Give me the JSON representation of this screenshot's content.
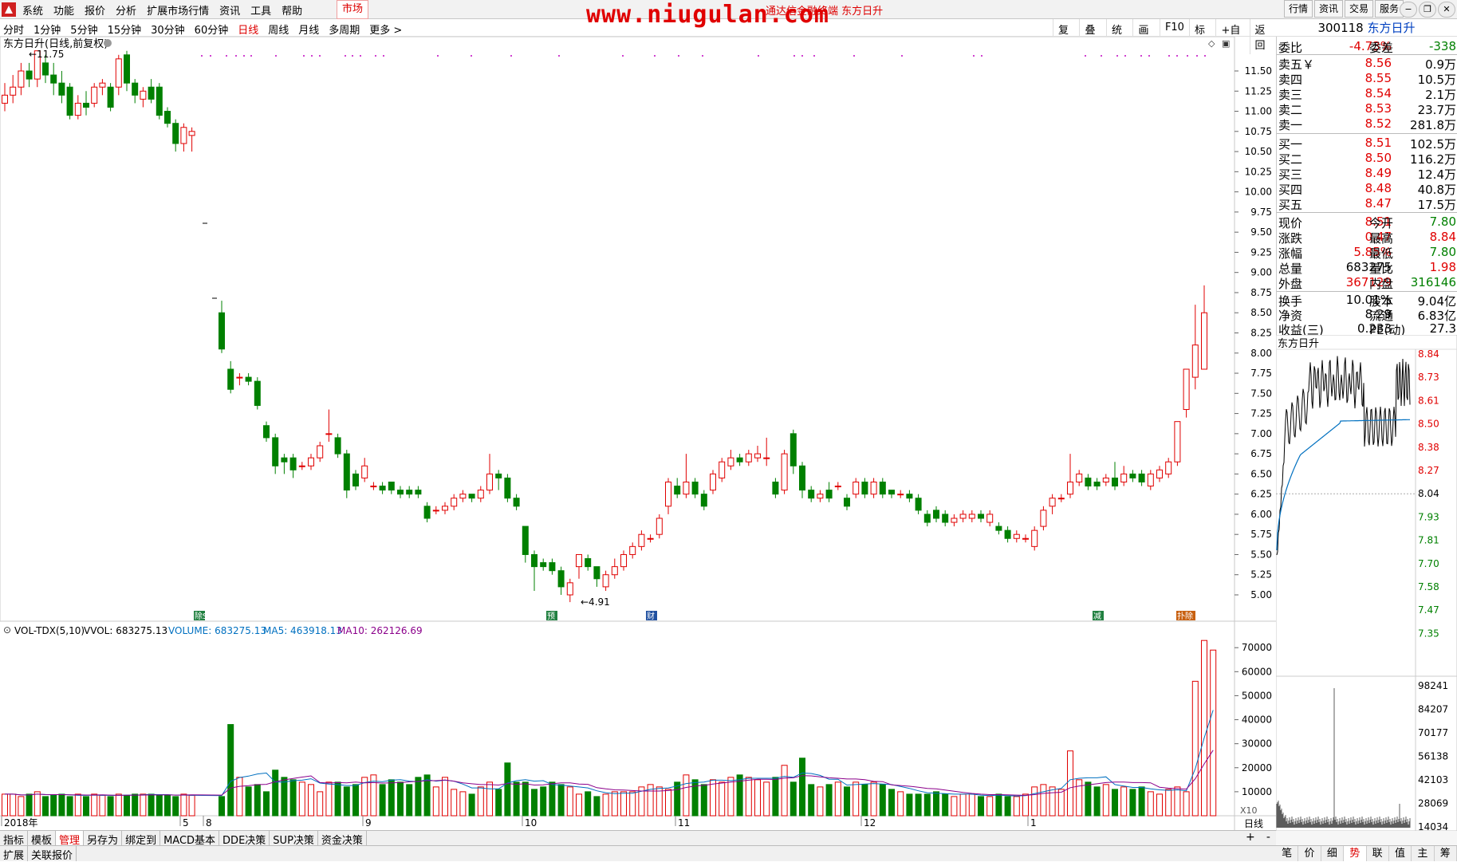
{
  "menubar": {
    "items": [
      "系统",
      "功能",
      "报价",
      "分析",
      "扩展市场行情",
      "资讯",
      "工具",
      "帮助"
    ],
    "market_label": "市场",
    "center_title": "通达信金融终端 东方日升",
    "watermark": "www.niugulan.com",
    "right_buttons": [
      "行情",
      "资讯",
      "交易",
      "服务"
    ]
  },
  "periodbar": {
    "periods": [
      "分时",
      "1分钟",
      "5分钟",
      "15分钟",
      "30分钟",
      "60分钟",
      "日线",
      "周线",
      "月线",
      "多周期",
      "更多 >"
    ],
    "active": "日线",
    "tools": [
      "复权",
      "叠加",
      "统计",
      "画线",
      "F10",
      "标记",
      "+自选",
      "返回"
    ]
  },
  "stock": {
    "code": "300118",
    "name": "东方日升"
  },
  "chart_header": "东方日升(日线,前复权)",
  "volume_header": {
    "name": "VOL-TDX(5,10)",
    "vvol": "VVOL: 683275.13",
    "volume": "VOLUME: 683275.13",
    "ma5": "MA5: 463918.13",
    "ma10": "MA10: 262126.69"
  },
  "colors": {
    "up": "#e00000",
    "down": "#008000",
    "ma5": "#0070c0",
    "ma10": "#8b008b"
  },
  "markers": {
    "high_label": "11.75",
    "low_label": "4.91"
  },
  "event_labels": [
    "除S",
    "预",
    "财",
    "减",
    "扑除"
  ],
  "x_axis": {
    "labels": [
      "2018年",
      "5",
      "8",
      "9",
      "10",
      "11",
      "12",
      "1"
    ],
    "period": "日线"
  },
  "price_axis": [
    "11.50",
    "11.25",
    "11.00",
    "10.75",
    "10.50",
    "10.25",
    "10.00",
    "9.75",
    "9.50",
    "9.25",
    "9.00",
    "8.75",
    "8.50",
    "8.25",
    "8.00",
    "7.75",
    "7.50",
    "7.25",
    "7.00",
    "6.75",
    "6.50",
    "6.25",
    "6.00",
    "5.75",
    "5.50",
    "5.25",
    "5.00"
  ],
  "vol_axis": [
    "70000",
    "60000",
    "50000",
    "40000",
    "30000",
    "20000",
    "10000"
  ],
  "vol_unit": "X10",
  "quote": {
    "webi": {
      "label": "委比",
      "value": "-4.73%",
      "label2": "委差",
      "value2": "-338"
    },
    "asks": [
      {
        "label": "卖五￥",
        "price": "8.56",
        "vol": "0.9万"
      },
      {
        "label": "卖四",
        "price": "8.55",
        "vol": "10.5万"
      },
      {
        "label": "卖三",
        "price": "8.54",
        "vol": "2.1万"
      },
      {
        "label": "卖二",
        "price": "8.53",
        "vol": "23.7万"
      },
      {
        "label": "卖一",
        "price": "8.52",
        "vol": "281.8万"
      }
    ],
    "bids": [
      {
        "label": "买一",
        "price": "8.51",
        "vol": "102.5万"
      },
      {
        "label": "买二",
        "price": "8.50",
        "vol": "116.2万"
      },
      {
        "label": "买三",
        "price": "8.49",
        "vol": "12.4万"
      },
      {
        "label": "买四",
        "price": "8.48",
        "vol": "40.8万"
      },
      {
        "label": "买五",
        "price": "8.47",
        "vol": "17.5万"
      }
    ],
    "stats": [
      {
        "l1": "现价",
        "v1": "8.51",
        "c1": "red",
        "l2": "今开",
        "v2": "7.80",
        "c2": "green"
      },
      {
        "l1": "涨跌",
        "v1": "0.47",
        "c1": "red",
        "l2": "最高",
        "v2": "8.84",
        "c2": "red"
      },
      {
        "l1": "涨幅",
        "v1": "5.85%",
        "c1": "red",
        "l2": "最低",
        "v2": "7.80",
        "c2": "green"
      },
      {
        "l1": "总量",
        "v1": "683275",
        "c1": "",
        "l2": "量比",
        "v2": "1.98",
        "c2": "red"
      },
      {
        "l1": "外盘",
        "v1": "367129",
        "c1": "red",
        "l2": "内盘",
        "v2": "316146",
        "c2": "green"
      }
    ],
    "stats2": [
      {
        "l1": "换手",
        "v1": "10.01%",
        "l2": "股本",
        "v2": "9.04亿"
      },
      {
        "l1": "净资",
        "v1": "8.29",
        "l2": "流通",
        "v2": "6.83亿"
      },
      {
        "l1": "收益(三)",
        "v1": "0.233",
        "l2": "PE(动)",
        "v2": "27.3"
      }
    ]
  },
  "mini": {
    "title": "东方日升",
    "price_axis": [
      "8.84",
      "8.73",
      "8.61",
      "8.50",
      "8.38",
      "8.27",
      "8.04",
      "7.93",
      "7.81",
      "7.70",
      "7.58",
      "7.47",
      "7.35"
    ],
    "vol_axis": [
      "98241",
      "84207",
      "70177",
      "56138",
      "42103",
      "28069",
      "14034"
    ]
  },
  "bottom_tabs": [
    "指标",
    "模板",
    "管理",
    "另存为",
    "绑定到",
    "MACD基本",
    "DDE决策",
    "SUP决策",
    "资金决策"
  ],
  "bottom_active": "管理",
  "bottom_tabs2": [
    "扩展",
    "关联报价"
  ],
  "right_tabs": [
    "笔",
    "价",
    "细",
    "势",
    "联",
    "值",
    "主",
    "筹"
  ],
  "right_active": "势",
  "nav_buttons": [
    "+",
    "-"
  ],
  "chart_data": {
    "type": "candlestick",
    "title": "东方日升(日线,前复权)",
    "ylim": [
      4.75,
      11.75
    ],
    "candles": [
      [
        11.1,
        11.2,
        11.0,
        11.35
      ],
      [
        11.2,
        11.3,
        11.1,
        11.45
      ],
      [
        11.3,
        11.5,
        11.2,
        11.6
      ],
      [
        11.5,
        11.4,
        11.3,
        11.6
      ],
      [
        11.4,
        11.75,
        11.3,
        11.75
      ],
      [
        11.6,
        11.45,
        11.35,
        11.7
      ],
      [
        11.45,
        11.35,
        11.2,
        11.6
      ],
      [
        11.35,
        11.2,
        11.1,
        11.5
      ],
      [
        11.3,
        10.95,
        10.9,
        11.35
      ],
      [
        10.95,
        11.1,
        10.9,
        11.2
      ],
      [
        11.1,
        11.05,
        10.95,
        11.25
      ],
      [
        11.1,
        11.3,
        11.05,
        11.35
      ],
      [
        11.3,
        11.35,
        11.2,
        11.4
      ],
      [
        11.3,
        11.05,
        11.0,
        11.35
      ],
      [
        11.3,
        11.65,
        11.2,
        11.7
      ],
      [
        11.7,
        11.35,
        11.25,
        11.75
      ],
      [
        11.35,
        11.2,
        11.1,
        11.4
      ],
      [
        11.15,
        11.25,
        11.05,
        11.3
      ],
      [
        11.3,
        11.15,
        11.1,
        11.4
      ],
      [
        11.3,
        10.95,
        10.9,
        11.35
      ],
      [
        11.0,
        10.85,
        10.8,
        11.05
      ],
      [
        10.85,
        10.6,
        10.5,
        10.9
      ],
      [
        10.6,
        10.8,
        10.5,
        10.85
      ],
      [
        10.7,
        10.75,
        10.5,
        10.8
      ],
      [
        8.5,
        8.05,
        8.0,
        8.65
      ],
      [
        7.8,
        7.55,
        7.5,
        7.9
      ],
      [
        7.7,
        7.7,
        7.6,
        7.75
      ],
      [
        7.7,
        7.65,
        7.6,
        7.75
      ],
      [
        7.65,
        7.35,
        7.3,
        7.7
      ],
      [
        7.1,
        6.95,
        6.9,
        7.15
      ],
      [
        6.95,
        6.6,
        6.5,
        7.0
      ],
      [
        6.7,
        6.65,
        6.5,
        6.75
      ],
      [
        6.7,
        6.55,
        6.45,
        6.75
      ],
      [
        6.6,
        6.6,
        6.55,
        6.65
      ],
      [
        6.6,
        6.7,
        6.55,
        6.75
      ],
      [
        6.7,
        6.85,
        6.65,
        6.9
      ],
      [
        7.0,
        7.0,
        6.9,
        7.3
      ],
      [
        6.95,
        6.75,
        6.7,
        7.0
      ],
      [
        6.75,
        6.3,
        6.2,
        6.8
      ],
      [
        6.5,
        6.35,
        6.3,
        6.55
      ],
      [
        6.45,
        6.6,
        6.4,
        6.7
      ],
      [
        6.35,
        6.35,
        6.3,
        6.4
      ],
      [
        6.35,
        6.3,
        6.25,
        6.4
      ],
      [
        6.4,
        6.3,
        6.25,
        6.4
      ],
      [
        6.3,
        6.25,
        6.2,
        6.35
      ],
      [
        6.3,
        6.25,
        6.2,
        6.35
      ],
      [
        6.3,
        6.25,
        6.2,
        6.35
      ],
      [
        6.1,
        5.95,
        5.9,
        6.15
      ],
      [
        6.05,
        6.05,
        6.0,
        6.1
      ],
      [
        6.05,
        6.1,
        6.0,
        6.15
      ],
      [
        6.1,
        6.2,
        6.05,
        6.25
      ],
      [
        6.2,
        6.25,
        6.15,
        6.3
      ],
      [
        6.25,
        6.2,
        6.15,
        6.25
      ],
      [
        6.2,
        6.3,
        6.15,
        6.35
      ],
      [
        6.3,
        6.5,
        6.25,
        6.75
      ],
      [
        6.5,
        6.45,
        6.3,
        6.55
      ],
      [
        6.45,
        6.2,
        6.15,
        6.5
      ],
      [
        6.2,
        6.1,
        6.05,
        6.25
      ],
      [
        5.85,
        5.5,
        5.4,
        5.85
      ],
      [
        5.5,
        5.35,
        5.05,
        5.55
      ],
      [
        5.4,
        5.35,
        5.3,
        5.45
      ],
      [
        5.4,
        5.3,
        5.25,
        5.45
      ],
      [
        5.3,
        5.1,
        5.0,
        5.35
      ],
      [
        5.0,
        5.15,
        4.91,
        5.2
      ],
      [
        5.35,
        5.5,
        5.2,
        5.5
      ],
      [
        5.45,
        5.35,
        5.3,
        5.5
      ],
      [
        5.35,
        5.2,
        5.1,
        5.35
      ],
      [
        5.1,
        5.25,
        5.05,
        5.3
      ],
      [
        5.25,
        5.35,
        5.2,
        5.45
      ],
      [
        5.35,
        5.5,
        5.3,
        5.55
      ],
      [
        5.5,
        5.6,
        5.45,
        5.65
      ],
      [
        5.6,
        5.75,
        5.55,
        5.8
      ],
      [
        5.7,
        5.7,
        5.65,
        5.75
      ],
      [
        5.75,
        5.95,
        5.7,
        6.0
      ],
      [
        6.1,
        6.4,
        6.0,
        6.45
      ],
      [
        6.35,
        6.25,
        6.2,
        6.45
      ],
      [
        6.25,
        6.4,
        6.2,
        6.75
      ],
      [
        6.4,
        6.25,
        6.2,
        6.45
      ],
      [
        6.25,
        6.1,
        6.05,
        6.3
      ],
      [
        6.3,
        6.5,
        6.25,
        6.55
      ],
      [
        6.45,
        6.65,
        6.4,
        6.7
      ],
      [
        6.6,
        6.7,
        6.55,
        6.8
      ],
      [
        6.7,
        6.65,
        6.6,
        6.75
      ],
      [
        6.65,
        6.75,
        6.6,
        6.8
      ],
      [
        6.7,
        6.75,
        6.65,
        6.85
      ],
      [
        6.7,
        6.7,
        6.6,
        6.95
      ],
      [
        6.4,
        6.25,
        6.2,
        6.45
      ],
      [
        6.3,
        6.75,
        6.25,
        6.8
      ],
      [
        7.0,
        6.6,
        6.5,
        7.05
      ],
      [
        6.6,
        6.3,
        6.2,
        6.65
      ],
      [
        6.3,
        6.2,
        6.15,
        6.35
      ],
      [
        6.2,
        6.25,
        6.15,
        6.3
      ],
      [
        6.3,
        6.2,
        6.15,
        6.4
      ],
      [
        6.35,
        6.35,
        6.3,
        6.4
      ],
      [
        6.2,
        6.1,
        6.05,
        6.25
      ],
      [
        6.25,
        6.4,
        6.2,
        6.45
      ],
      [
        6.4,
        6.25,
        6.2,
        6.45
      ],
      [
        6.25,
        6.4,
        6.2,
        6.45
      ],
      [
        6.4,
        6.25,
        6.2,
        6.45
      ],
      [
        6.3,
        6.25,
        6.2,
        6.3
      ],
      [
        6.25,
        6.25,
        6.2,
        6.3
      ],
      [
        6.25,
        6.2,
        6.15,
        6.3
      ],
      [
        6.2,
        6.05,
        6.0,
        6.25
      ],
      [
        6.0,
        5.9,
        5.85,
        6.05
      ],
      [
        6.05,
        5.95,
        5.9,
        6.1
      ],
      [
        6.0,
        5.9,
        5.85,
        6.05
      ],
      [
        5.9,
        5.95,
        5.85,
        6.0
      ],
      [
        5.95,
        6.0,
        5.9,
        6.05
      ],
      [
        5.95,
        6.0,
        5.9,
        6.05
      ],
      [
        6.0,
        5.95,
        5.9,
        6.05
      ],
      [
        5.9,
        6.0,
        5.85,
        6.05
      ],
      [
        5.85,
        5.8,
        5.75,
        5.9
      ],
      [
        5.8,
        5.7,
        5.65,
        5.85
      ],
      [
        5.7,
        5.75,
        5.65,
        5.8
      ],
      [
        5.7,
        5.7,
        5.65,
        5.75
      ],
      [
        5.6,
        5.8,
        5.55,
        5.85
      ],
      [
        5.85,
        6.05,
        5.8,
        6.1
      ],
      [
        6.1,
        6.2,
        6.0,
        6.25
      ],
      [
        6.2,
        6.2,
        6.15,
        6.25
      ],
      [
        6.25,
        6.4,
        6.2,
        6.75
      ],
      [
        6.4,
        6.5,
        6.35,
        6.55
      ],
      [
        6.45,
        6.35,
        6.3,
        6.5
      ],
      [
        6.4,
        6.35,
        6.3,
        6.45
      ],
      [
        6.4,
        6.45,
        6.35,
        6.5
      ],
      [
        6.45,
        6.35,
        6.3,
        6.65
      ],
      [
        6.4,
        6.5,
        6.35,
        6.6
      ],
      [
        6.5,
        6.45,
        6.4,
        6.55
      ],
      [
        6.5,
        6.4,
        6.35,
        6.55
      ],
      [
        6.35,
        6.5,
        6.3,
        6.55
      ],
      [
        6.45,
        6.55,
        6.4,
        6.6
      ],
      [
        6.5,
        6.65,
        6.45,
        6.7
      ],
      [
        6.65,
        7.15,
        6.6,
        7.15
      ],
      [
        7.3,
        7.8,
        7.2,
        7.8
      ],
      [
        7.7,
        8.1,
        7.55,
        8.6
      ],
      [
        7.8,
        8.5,
        7.8,
        8.84
      ]
    ],
    "volume_x10": [
      9000,
      9000,
      8000,
      9000,
      10000,
      8000,
      8500,
      9000,
      8000,
      9000,
      8000,
      9000,
      8500,
      8000,
      9000,
      8500,
      9000,
      9000,
      9000,
      8500,
      8500,
      8000,
      9000,
      8500,
      8000,
      38000,
      16000,
      12000,
      13000,
      10000,
      19000,
      16000,
      15000,
      14000,
      13000,
      10000,
      14000,
      14000,
      12000,
      13000,
      16000,
      17000,
      13000,
      15000,
      14000,
      13000,
      16000,
      17000,
      12000,
      16000,
      11000,
      10000,
      9000,
      12000,
      14000,
      11000,
      22000,
      14000,
      14000,
      11000,
      12000,
      14000,
      13000,
      12000,
      9000,
      10000,
      8000,
      9000,
      10000,
      10000,
      10000,
      12000,
      13000,
      12000,
      11000,
      14000,
      17000,
      15000,
      13000,
      15000,
      14000,
      16000,
      17000,
      16000,
      15000,
      14000,
      16000,
      21000,
      14000,
      24000,
      13000,
      12000,
      13000,
      14000,
      12000,
      14000,
      13000,
      14000,
      13000,
      11000,
      10000,
      9000,
      9000,
      9000,
      10000,
      9000,
      8000,
      9000,
      9000,
      8000,
      8000,
      9000,
      8000,
      8000,
      9000,
      12000,
      13000,
      12000,
      11000,
      27000,
      15000,
      14000,
      12000,
      13000,
      11000,
      12000,
      11000,
      12000,
      10000,
      9000,
      11000,
      12000,
      10000,
      56000,
      73000,
      69000
    ]
  }
}
